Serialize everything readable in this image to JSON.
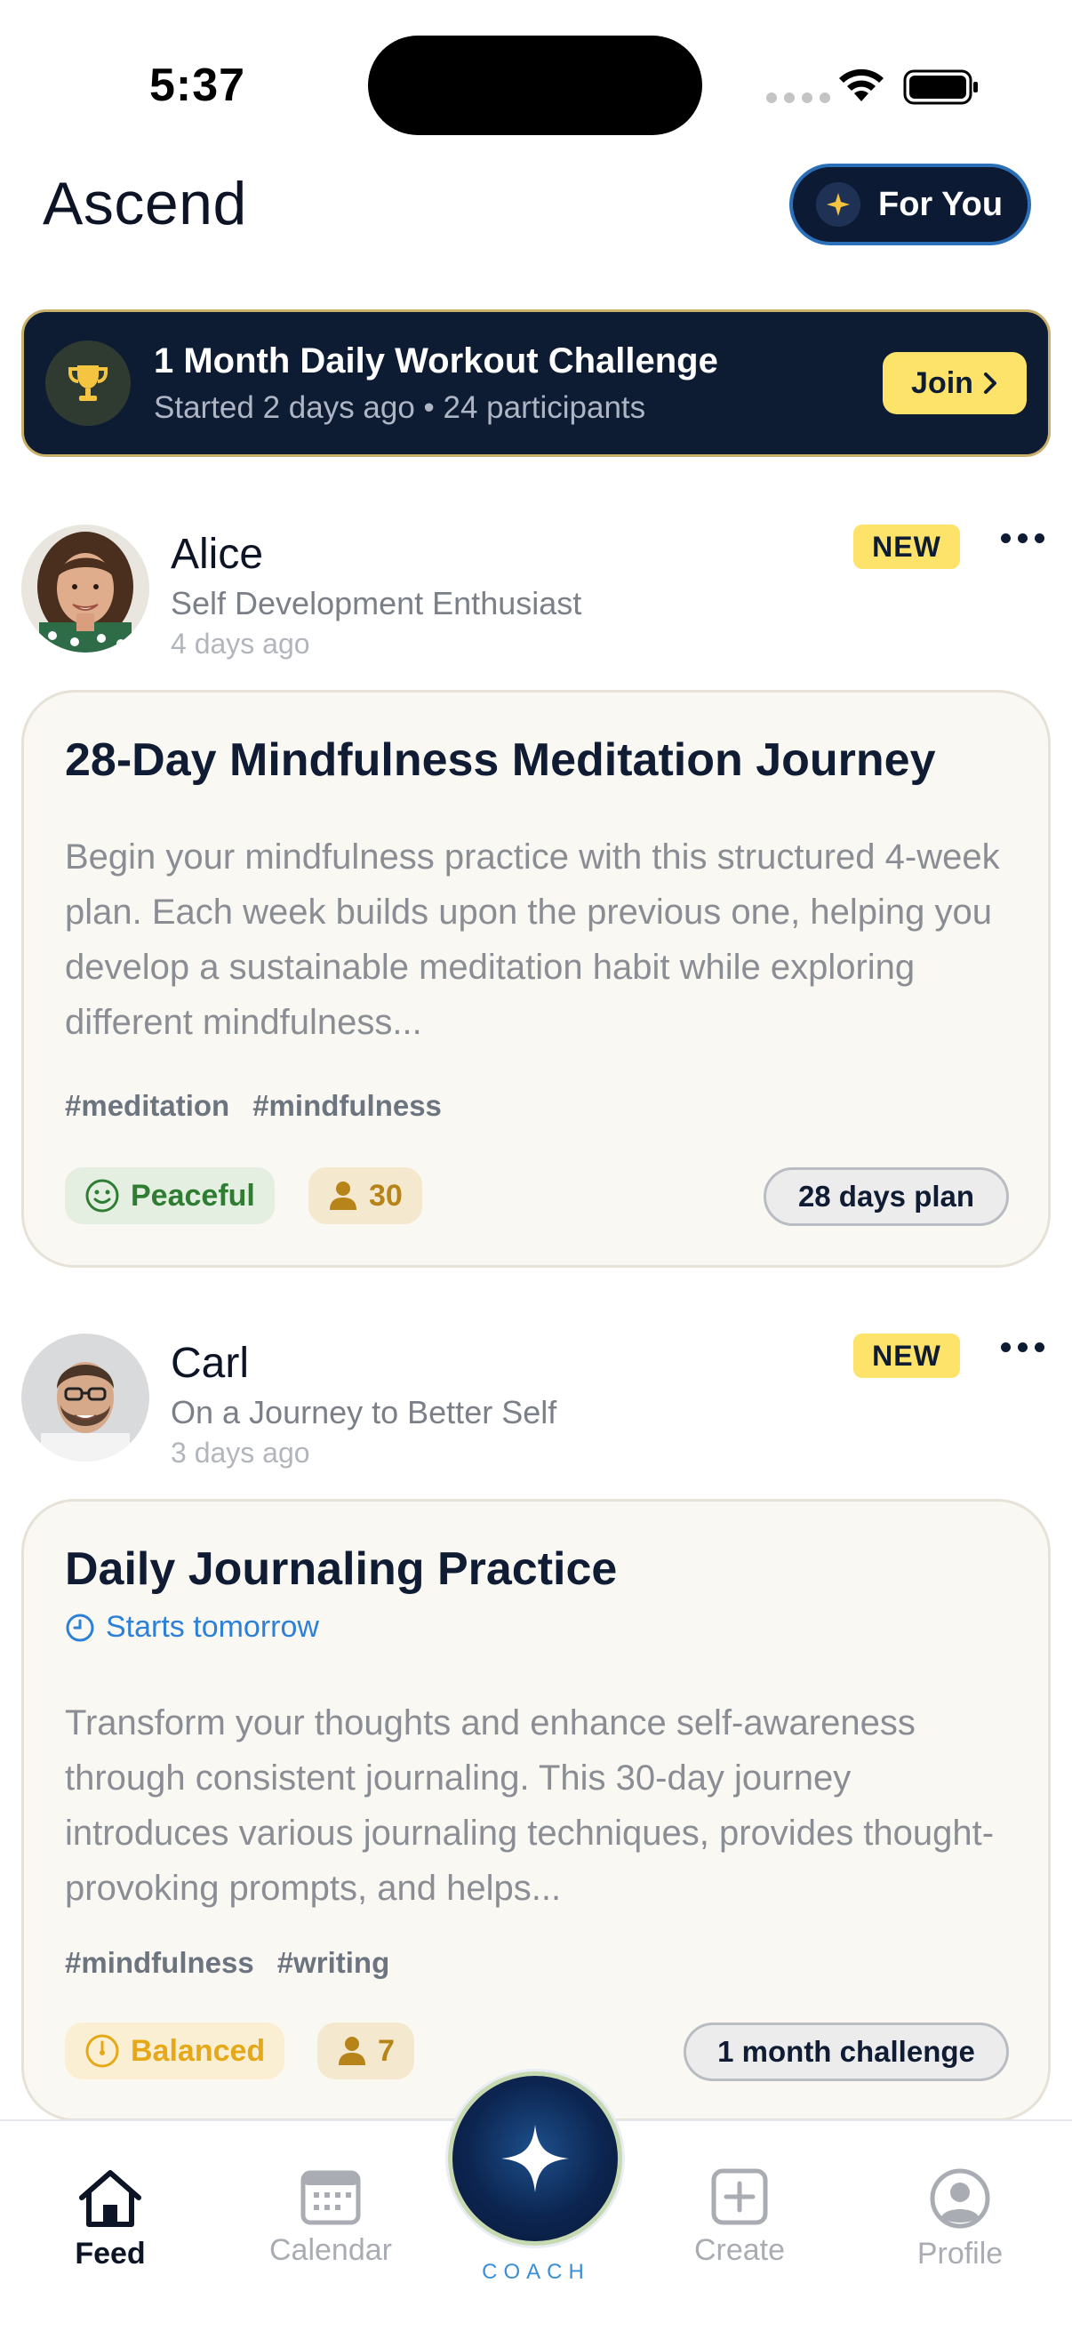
{
  "status_bar": {
    "time": "5:37"
  },
  "header": {
    "title": "Ascend",
    "for_you_label": "For You"
  },
  "challenge": {
    "title": "1 Month Daily Workout Challenge",
    "subtitle": "Started 2 days ago • 24 participants",
    "join_label": "Join"
  },
  "posts": [
    {
      "author": "Alice",
      "author_subtitle": "Self Development Enthusiast",
      "time": "4 days ago",
      "badge": "NEW",
      "title": "28-Day Mindfulness Meditation Journey",
      "description": "Begin your mindfulness practice with this structured 4-week plan. Each week builds upon the previous one, helping you develop a sustainable meditation habit while exploring different mindfulness...",
      "tags": [
        "#meditation",
        "#mindfulness"
      ],
      "mood": "Peaceful",
      "participants": "30",
      "plan": "28 days plan"
    },
    {
      "author": "Carl",
      "author_subtitle": "On a Journey to Better Self",
      "time": "3 days ago",
      "badge": "NEW",
      "title": "Daily Journaling Practice",
      "starts": "Starts tomorrow",
      "description": "Transform your thoughts and enhance self-awareness through consistent journaling. This 30-day journey introduces various journaling techniques, provides thought-provoking prompts, and helps...",
      "tags": [
        "#mindfulness",
        "#writing"
      ],
      "mood": "Balanced",
      "participants": "7",
      "plan": "1 month challenge"
    }
  ],
  "bottom_nav": {
    "feed": "Feed",
    "calendar": "Calendar",
    "coach": "COACH",
    "create": "Create",
    "profile": "Profile"
  },
  "colors": {
    "navy": "#0d1b33",
    "accent_yellow": "#fde36a",
    "peaceful_green": "#2e7d32",
    "balanced_orange": "#e6a817",
    "link_blue": "#2c80d8"
  }
}
